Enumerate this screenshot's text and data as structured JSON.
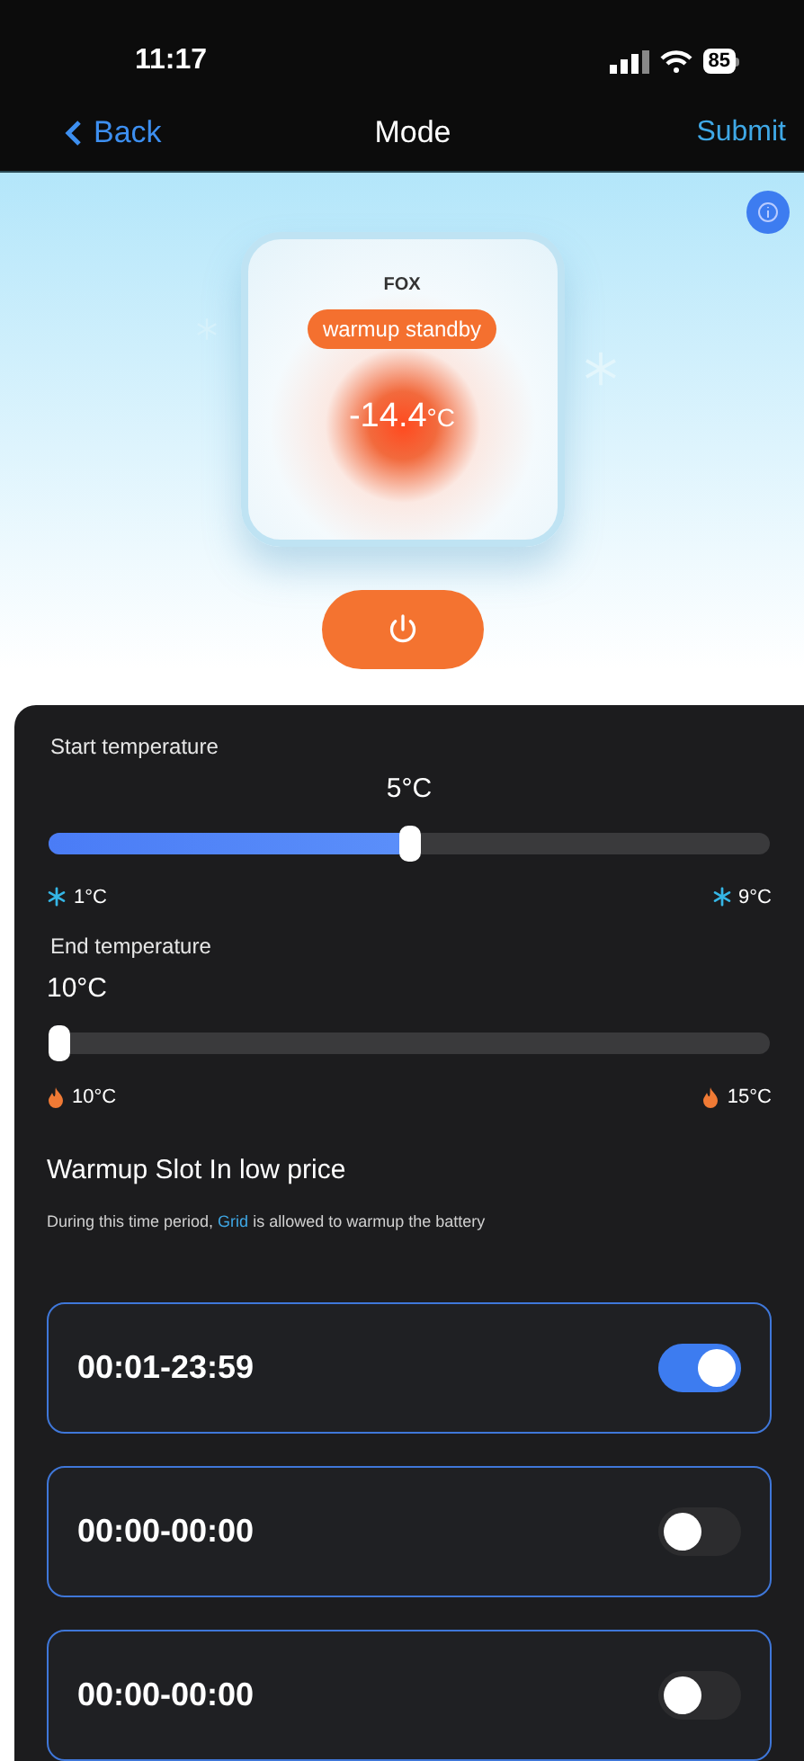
{
  "status_bar": {
    "time": "11:17",
    "battery": "85"
  },
  "nav": {
    "back": "Back",
    "title": "Mode",
    "action": "Submit"
  },
  "hero": {
    "brand": "FOX",
    "state": "warmup standby",
    "temperature": "-14.4",
    "unit": "°C"
  },
  "start_temperature": {
    "label": "Start temperature",
    "value": "5°C",
    "level": 0.5,
    "min": "1°C",
    "max": "9°C",
    "kind": "cold"
  },
  "end_temperature": {
    "label": "End temperature",
    "value": "10°C",
    "level": 0,
    "min": "10°C",
    "max": "15°C",
    "kind": "hot"
  },
  "warmup_slot": {
    "title": "Warmup Slot In low price",
    "description_before": "During this time period, ",
    "description_highlight": "Grid",
    "description_after": " is allowed to warmup the battery"
  },
  "slots": [
    {
      "time": "00:01-23:59",
      "on": true
    },
    {
      "time": "00:00-00:00",
      "on": false
    },
    {
      "time": "00:00-00:00",
      "on": false
    }
  ]
}
